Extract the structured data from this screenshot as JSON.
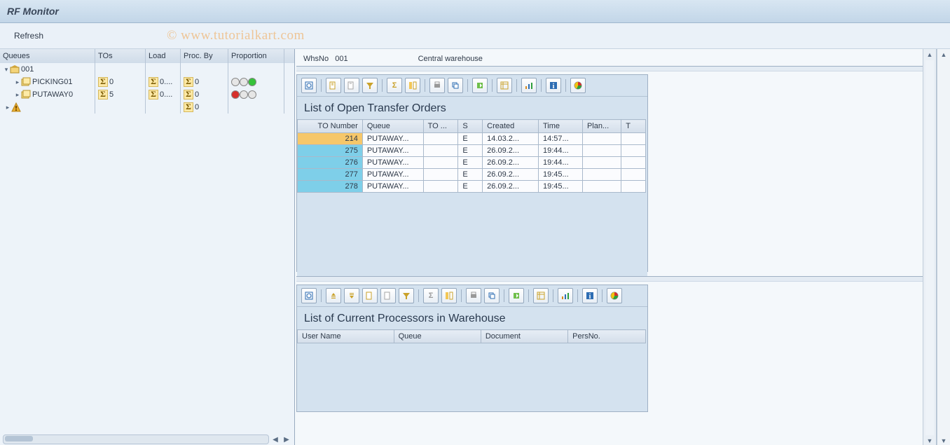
{
  "window": {
    "title": "RF Monitor"
  },
  "toolbar": {
    "refresh_label": "Refresh"
  },
  "watermark": "© www.tutorialkart.com",
  "tree": {
    "headers": {
      "queues": "Queues",
      "tos": "TOs",
      "load": "Load",
      "procby": "Proc. By",
      "proportion": "Proportion"
    },
    "root": {
      "label": "001",
      "children": [
        {
          "label": "PICKING01",
          "tos": "0",
          "load": "0....",
          "procby": "0",
          "lights": [
            "off",
            "off",
            "green"
          ]
        },
        {
          "label": "PUTAWAY0",
          "tos": "5",
          "load": "0....",
          "procby": "0",
          "lights": [
            "red",
            "off",
            "off"
          ]
        }
      ],
      "extra_procby": "0"
    }
  },
  "whs": {
    "label": "WhsNo",
    "no": "001",
    "desc": "Central warehouse"
  },
  "orders_panel": {
    "title": "List of Open Transfer Orders",
    "columns": [
      "TO Number",
      "Queue",
      "TO ...",
      "S",
      "Created",
      "Time",
      "Plan...",
      "T"
    ],
    "rows": [
      {
        "sel": "selected",
        "no": "214",
        "queue": "PUTAWAY...",
        "to": "",
        "s": "E",
        "created": "14.03.2...",
        "time": "14:57...",
        "plan": "",
        "t": ""
      },
      {
        "sel": "rowsel",
        "no": "275",
        "queue": "PUTAWAY...",
        "to": "",
        "s": "E",
        "created": "26.09.2...",
        "time": "19:44...",
        "plan": "",
        "t": ""
      },
      {
        "sel": "rowsel",
        "no": "276",
        "queue": "PUTAWAY...",
        "to": "",
        "s": "E",
        "created": "26.09.2...",
        "time": "19:44...",
        "plan": "",
        "t": ""
      },
      {
        "sel": "rowsel",
        "no": "277",
        "queue": "PUTAWAY...",
        "to": "",
        "s": "E",
        "created": "26.09.2...",
        "time": "19:45...",
        "plan": "",
        "t": ""
      },
      {
        "sel": "rowsel",
        "no": "278",
        "queue": "PUTAWAY...",
        "to": "",
        "s": "E",
        "created": "26.09.2...",
        "time": "19:45...",
        "plan": "",
        "t": ""
      }
    ]
  },
  "processors_panel": {
    "title": "List of Current Processors in Warehouse",
    "columns": [
      "User Name",
      "Queue",
      "Document",
      "PersNo."
    ]
  },
  "iconset": {
    "details": "details-icon",
    "find": "find-icon",
    "find-next": "find-next-icon",
    "filter": "filter-icon",
    "sum": "sum-icon",
    "subtotal": "subtotal-icon",
    "print": "print-icon",
    "view": "view-icon",
    "export": "export-icon",
    "layout": "layout-icon",
    "graphic": "graphic-icon",
    "info": "info-icon",
    "abc": "abc-icon",
    "sort": "sort-icon",
    "print2": "print-icon",
    "mail": "mail-icon"
  }
}
